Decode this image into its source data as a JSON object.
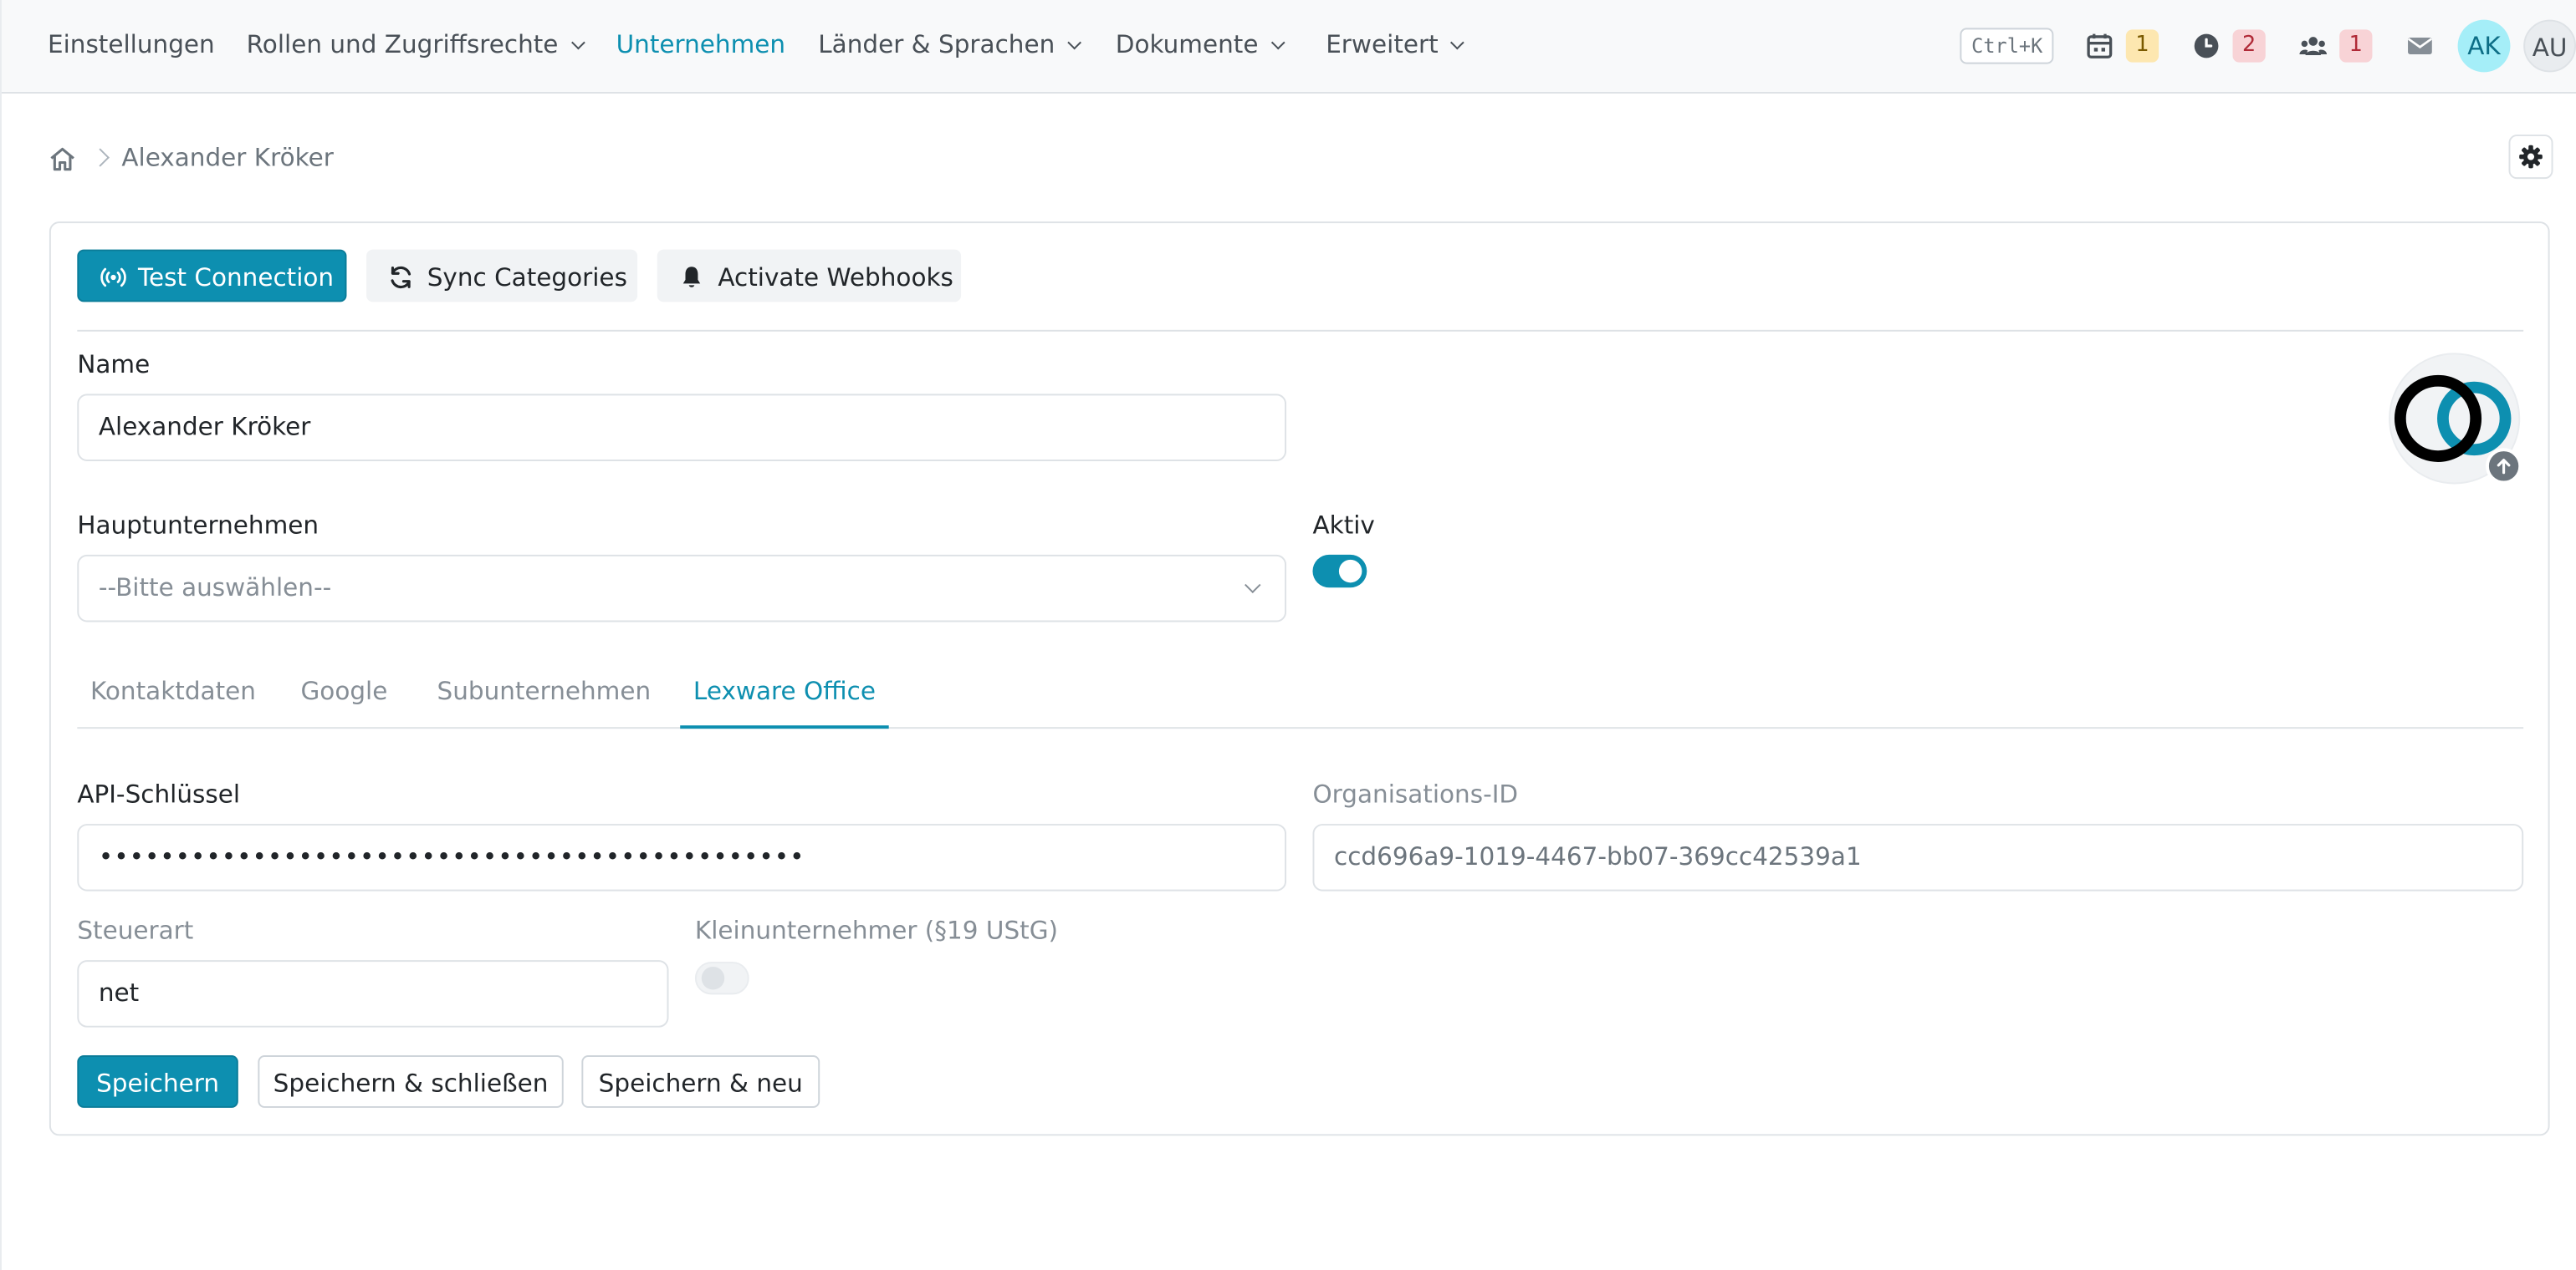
{
  "nav": {
    "items": [
      {
        "label": "Einstellungen",
        "dropdown": false,
        "active": false
      },
      {
        "label": "Rollen und Zugriffsrechte",
        "dropdown": true,
        "active": false
      },
      {
        "label": "Unternehmen",
        "dropdown": false,
        "active": true
      },
      {
        "label": "Länder & Sprachen",
        "dropdown": true,
        "active": false
      },
      {
        "label": "Dokumente",
        "dropdown": true,
        "active": false
      },
      {
        "label": "Erweitert",
        "dropdown": true,
        "active": false
      }
    ],
    "shortcut": "Ctrl+K",
    "badges": {
      "calendar": "1",
      "clock": "2",
      "users": "1"
    },
    "avatars": {
      "current": "AK",
      "other": "AU"
    }
  },
  "breadcrumb": {
    "current": "Alexander Kröker"
  },
  "toolbar": {
    "test_connection": "Test Connection",
    "sync_categories": "Sync Categories",
    "activate_webhooks": "Activate Webhooks"
  },
  "form": {
    "name_label": "Name",
    "name_value": "Alexander Kröker",
    "parent_label": "Hauptunternehmen",
    "parent_placeholder": "--Bitte auswählen--",
    "active_label": "Aktiv",
    "active_on": true
  },
  "tabs": [
    {
      "label": "Kontaktdaten",
      "active": false
    },
    {
      "label": "Google",
      "active": false
    },
    {
      "label": "Subunternehmen",
      "active": false
    },
    {
      "label": "Lexware Office",
      "active": true
    }
  ],
  "lexware": {
    "api_key_label": "API-Schlüssel",
    "api_key_value": "••••••••••••••••••••••••••••••••••••••••••••••",
    "org_id_label": "Organisations-ID",
    "org_id_value": "ccd696a9-1019-4467-bb07-369cc42539a1",
    "tax_type_label": "Steuerart",
    "tax_type_value": "net",
    "small_business_label": "Kleinunternehmer (§19 UStG)",
    "small_business_on": false
  },
  "actions": {
    "save": "Speichern",
    "save_close": "Speichern & schließen",
    "save_new": "Speichern & neu"
  },
  "colors": {
    "accent": "#0d8fb0",
    "warning_badge": "#fde7b0",
    "danger_badge": "#f8d3d6"
  }
}
